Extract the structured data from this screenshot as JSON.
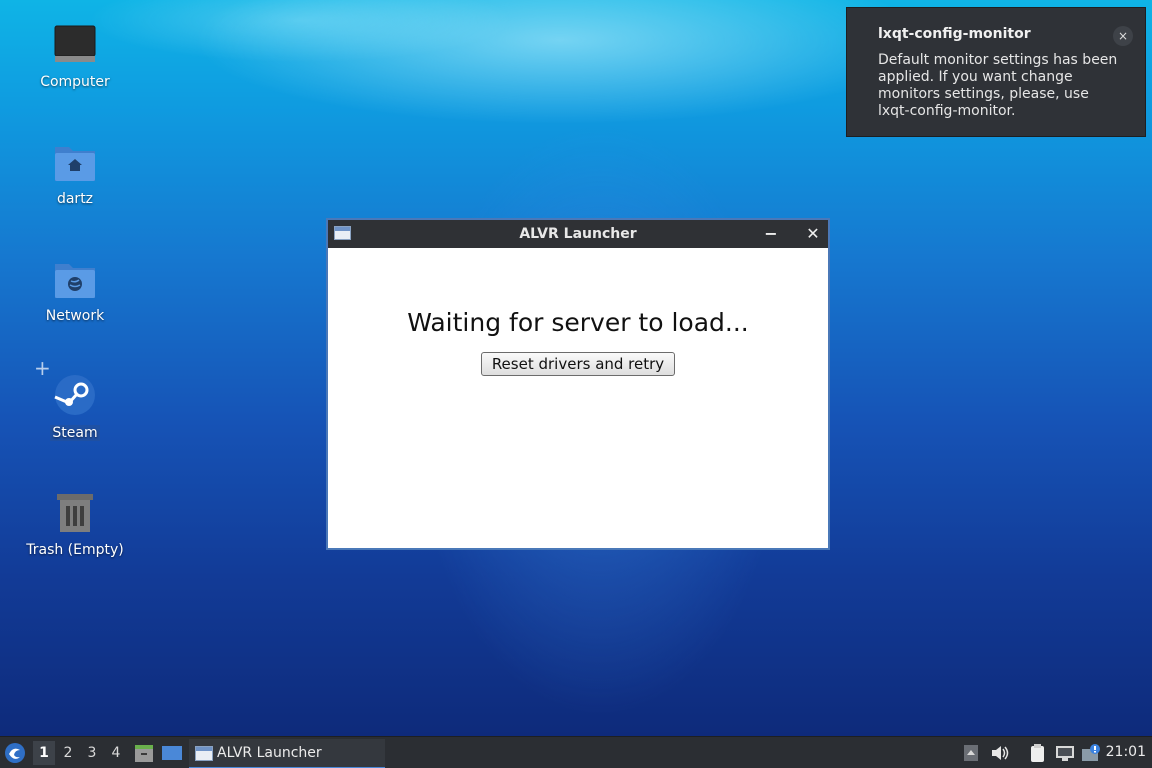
{
  "desktop": {
    "icons": [
      {
        "label": "Computer"
      },
      {
        "label": "dartz"
      },
      {
        "label": "Network"
      },
      {
        "label": "Steam"
      },
      {
        "label": "Trash (Empty)"
      }
    ]
  },
  "notification": {
    "title": "lxqt-config-monitor",
    "body": "Default monitor settings has been applied. If you want change monitors settings, please, use lxqt-config-monitor.",
    "close_glyph": "×"
  },
  "window": {
    "title": "ALVR Launcher",
    "minimize_glyph": "−",
    "close_glyph": "✕",
    "status_text": "Waiting for server to load...",
    "reset_button_label": "Reset drivers and retry"
  },
  "taskbar": {
    "workspaces": [
      "1",
      "2",
      "3",
      "4"
    ],
    "task_label": "ALVR Launcher",
    "clock": "21:01"
  },
  "colors": {
    "titlebar": "#2f3135",
    "taskbar": "#2b2e33",
    "accent": "#4a88d8"
  }
}
